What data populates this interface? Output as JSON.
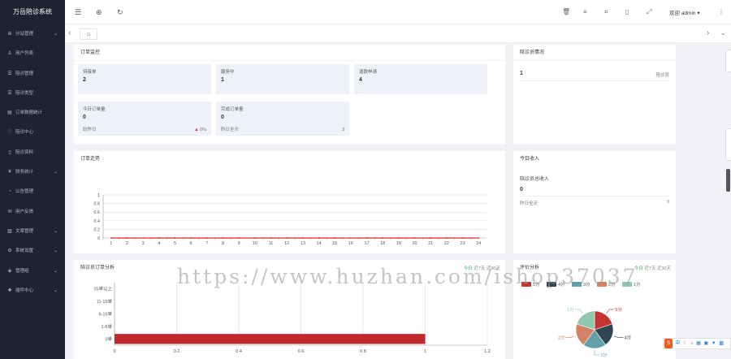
{
  "app": {
    "title": "万岳陪诊系统"
  },
  "sidebar": {
    "items": [
      {
        "label": "分站管理",
        "icon": "globe-icon",
        "has_arrow": true
      },
      {
        "label": "用户列表",
        "icon": "user-icon",
        "has_arrow": false
      },
      {
        "label": "陪诊管理",
        "icon": "list-icon",
        "has_arrow": false
      },
      {
        "label": "陪诊类型",
        "icon": "list-icon",
        "has_arrow": false
      },
      {
        "label": "订单数据统计",
        "icon": "document-icon",
        "has_arrow": false
      },
      {
        "label": "陪诊中心",
        "icon": "heart-icon",
        "has_arrow": false
      },
      {
        "label": "陪诊资料",
        "icon": "file-icon",
        "has_arrow": false
      },
      {
        "label": "财务统计",
        "icon": "money-icon",
        "has_arrow": true
      },
      {
        "label": "公告管理",
        "icon": "bell-icon",
        "has_arrow": false
      },
      {
        "label": "用户反馈",
        "icon": "feedback-icon",
        "has_arrow": false
      },
      {
        "label": "文章管理",
        "icon": "article-icon",
        "has_arrow": true
      },
      {
        "label": "系统设置",
        "icon": "gear-icon",
        "has_arrow": true
      },
      {
        "label": "管理组",
        "icon": "shield-icon",
        "has_arrow": true
      },
      {
        "label": "插件中心",
        "icon": "plugin-icon",
        "has_arrow": true
      }
    ]
  },
  "topbar": {
    "left_icons": [
      "menu-toggle-icon",
      "globe-icon",
      "refresh-icon"
    ],
    "right_icons": [
      "trash-icon",
      "list-icon",
      "lock-icon",
      "file-icon",
      "fullscreen-icon"
    ],
    "welcome": "欢迎",
    "username": "admin"
  },
  "tabs": {
    "home_icon": "home-icon"
  },
  "order_monitor": {
    "title": "订单监控",
    "stats": [
      {
        "label": "待接单",
        "value": "2"
      },
      {
        "label": "服务中",
        "value": "1"
      },
      {
        "label": "退款申请",
        "value": "4"
      }
    ],
    "today_orders": {
      "label": "今日订单量",
      "value": "0",
      "compare_label": "较昨日",
      "change": "0%"
    },
    "completed_orders": {
      "label": "完成订单量",
      "value": "0",
      "yesterday_label": "昨日全天",
      "yesterday_value": "3"
    }
  },
  "escort_status": {
    "title": "陪诊员情况",
    "count": "1",
    "label": "陪诊员"
  },
  "today_income": {
    "title": "今日收入",
    "label": "陪诊员总收入",
    "value": "0",
    "yesterday_label": "昨日全天",
    "yesterday_value": "0"
  },
  "order_trend": {
    "title": "订单走势",
    "chart_data": {
      "type": "line",
      "x": [
        1,
        2,
        3,
        4,
        5,
        6,
        7,
        8,
        9,
        10,
        11,
        12,
        13,
        14,
        15,
        16,
        17,
        18,
        19,
        20,
        21,
        22,
        23,
        24
      ],
      "series": [
        {
          "values": [
            0,
            0,
            0,
            0,
            0,
            0,
            0,
            0,
            0,
            0,
            0,
            0,
            0,
            0,
            0,
            0,
            0,
            0,
            0,
            0,
            0,
            0,
            0,
            0
          ]
        }
      ],
      "yticks": [
        "0",
        "0.2",
        "0.4",
        "0.6",
        "0.8",
        "1"
      ],
      "ylim": [
        0,
        1
      ],
      "color": "#d9272d",
      "grid": true
    }
  },
  "escort_orders": {
    "title": "陪诊员订单分析",
    "filter_active": "今日",
    "filter_7": "近7天",
    "filter_30": "近30天",
    "chart_data": {
      "type": "bar",
      "orientation": "horizontal",
      "categories": [
        "0单",
        "1-5单",
        "6-10单",
        "11-15单",
        "15单以上"
      ],
      "values": [
        1,
        0,
        0,
        0,
        0
      ],
      "xticks": [
        "0",
        "0.2",
        "0.4",
        "0.6",
        "0.8",
        "1",
        "1.2"
      ],
      "xlim": [
        0,
        1.2
      ],
      "color": "#c1292e",
      "grid": true
    }
  },
  "rating_analysis": {
    "title": "评价分析",
    "filter_active": "今日",
    "filter_7": "近7天",
    "filter_30": "近30天",
    "chart_data": {
      "type": "pie",
      "categories": [
        "5分",
        "4分",
        "3分",
        "2分",
        "1分"
      ],
      "values": [
        1,
        1,
        1,
        1,
        1
      ],
      "colors": [
        "#c23531",
        "#2f4554",
        "#61a0a8",
        "#d48265",
        "#91c7ae"
      ],
      "legend": "top"
    }
  },
  "watermark": "https://www.huzhan.com/ishop37037",
  "ime_toolbar": {
    "logo": "S",
    "lang": "中"
  }
}
